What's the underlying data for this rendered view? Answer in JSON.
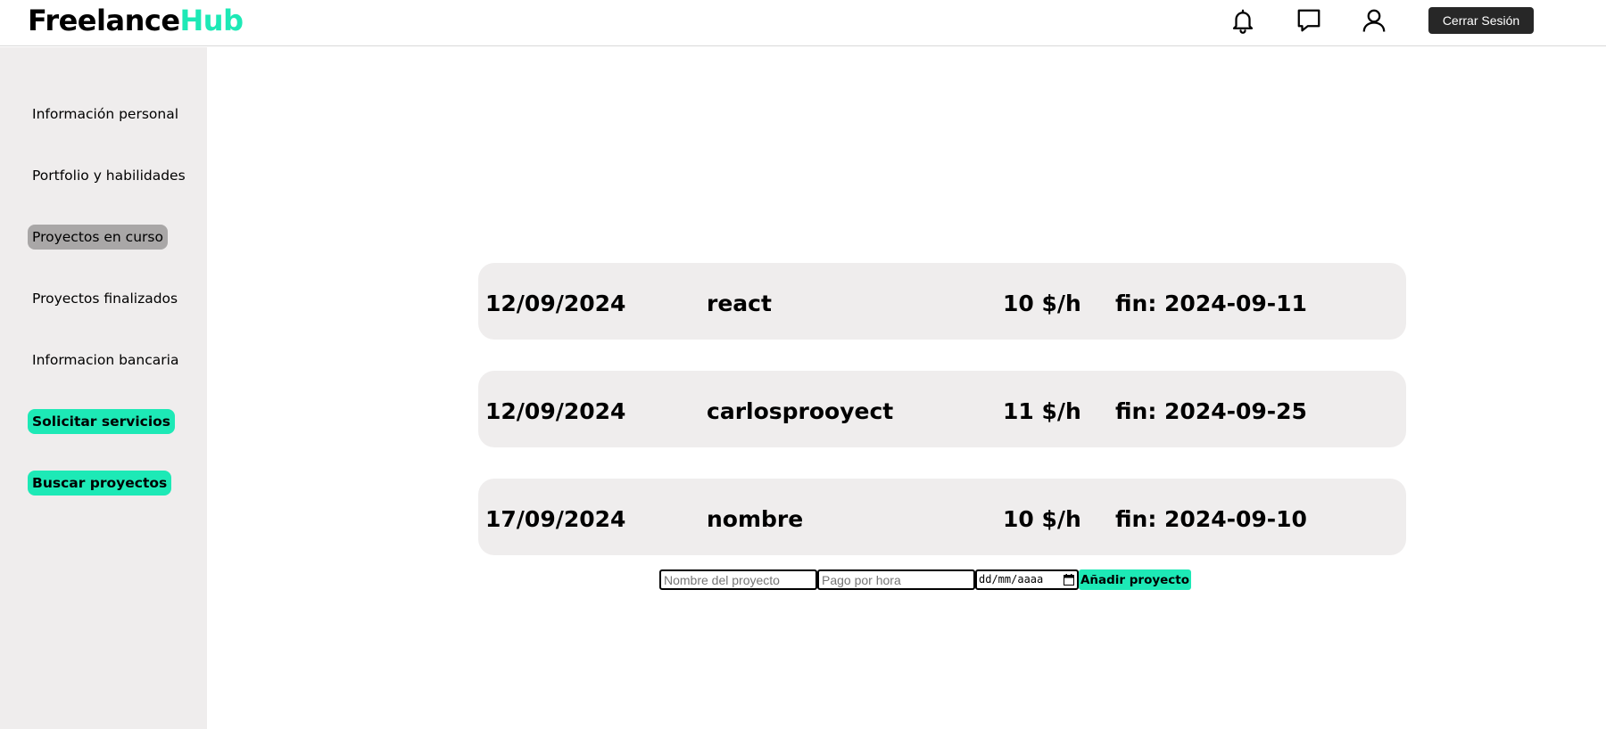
{
  "brand": {
    "part1": "Freelance",
    "part2": "Hub"
  },
  "header": {
    "icons": [
      "bell-icon",
      "chat-icon",
      "user-icon"
    ],
    "logout_label": "Cerrar Sesión"
  },
  "sidebar": {
    "items": [
      {
        "label": "Información personal",
        "state": "normal"
      },
      {
        "label": "Portfolio y habilidades",
        "state": "normal"
      },
      {
        "label": "Proyectos en curso",
        "state": "active"
      },
      {
        "label": "Proyectos finalizados",
        "state": "normal"
      },
      {
        "label": "Informacion bancaria",
        "state": "normal"
      },
      {
        "label": "Solicitar servicios",
        "state": "cta"
      },
      {
        "label": "Buscar proyectos",
        "state": "cta"
      }
    ]
  },
  "projects": [
    {
      "date": "12/09/2024",
      "name": "react",
      "rate": "10 $/h",
      "end": "fin: 2024-09-11"
    },
    {
      "date": "12/09/2024",
      "name": "carlosprooyect",
      "rate": "11 $/h",
      "end": "fin: 2024-09-25"
    },
    {
      "date": "17/09/2024",
      "name": "nombre",
      "rate": "10 $/h",
      "end": "fin: 2024-09-10"
    }
  ],
  "form": {
    "name_placeholder": "Nombre del proyecto",
    "name_value": "",
    "rate_placeholder": "Pago por hora",
    "rate_value": "",
    "date_placeholder": "dd/mm/aaaa",
    "add_label": "Añadir proyecto"
  },
  "colors": {
    "accent": "#1de9b6",
    "sidebar_bg": "#efeded",
    "card_bg": "#efeded",
    "active_bg": "#a9a7a7",
    "logout_bg": "#272727"
  }
}
